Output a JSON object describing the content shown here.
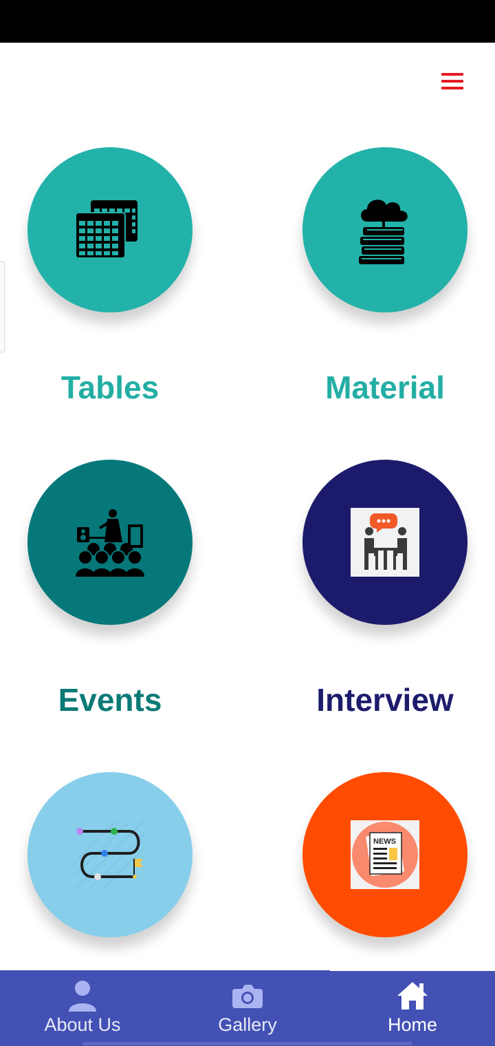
{
  "header": {
    "menu_icon": "hamburger-menu-icon",
    "menu_color": "#e31b23"
  },
  "tiles": [
    {
      "label": "Tables",
      "color": "#22b2a9",
      "label_color": "#23aea4",
      "icon": "tables-icon"
    },
    {
      "label": "Material",
      "color": "#22b2a9",
      "label_color": "#23aea4",
      "icon": "books-cloud-icon"
    },
    {
      "label": "Events",
      "color": "#06787a",
      "label_color": "#0a7a76",
      "icon": "presentation-audience-icon"
    },
    {
      "label": "Interview",
      "color": "#1c1b6b",
      "label_color": "#1d1c6c",
      "icon": "interview-icon"
    },
    {
      "label": "",
      "color": "#87ceeb",
      "icon": "roadmap-icon"
    },
    {
      "label": "",
      "color": "#ff4c00",
      "icon": "news-icon"
    }
  ],
  "bottom_nav": {
    "background": "#4351b5",
    "items": [
      {
        "label": "About Us",
        "icon": "person-icon"
      },
      {
        "label": "Gallery",
        "icon": "camera-icon"
      },
      {
        "label": "Home",
        "icon": "home-icon",
        "selected": true
      }
    ]
  }
}
